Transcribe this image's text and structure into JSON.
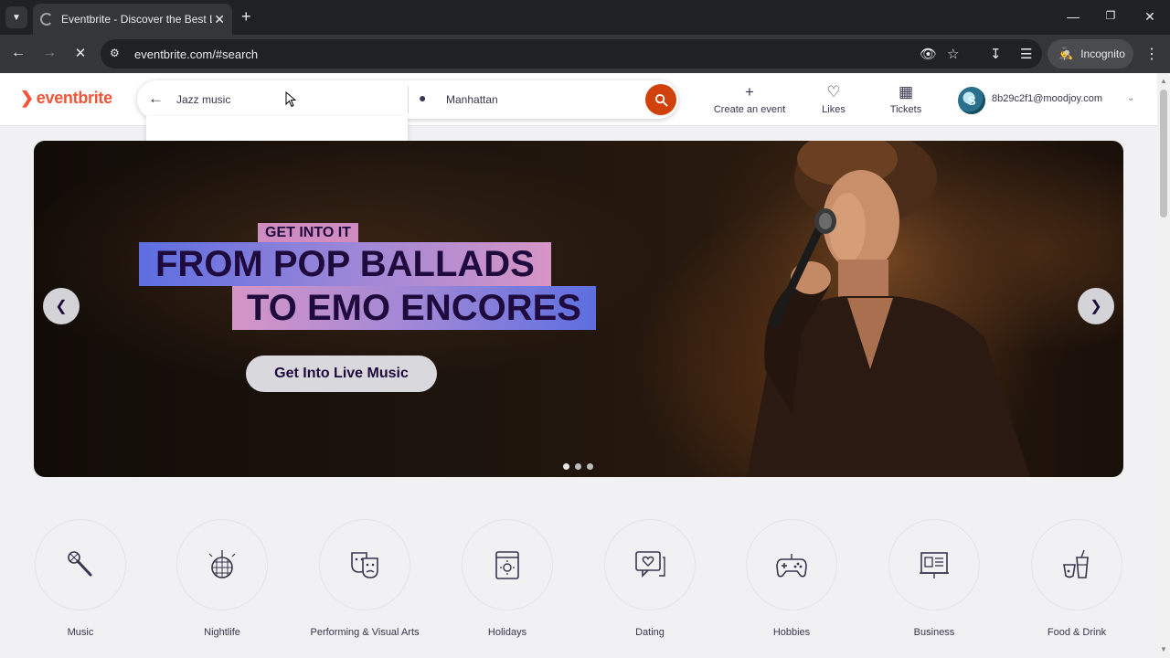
{
  "browser": {
    "tab_title": "Eventbrite - Discover the Best L",
    "url": "eventbrite.com/#search",
    "incognito_label": "Incognito"
  },
  "header": {
    "logo": "eventbrite",
    "search_query": "Jazz music",
    "location": "Manhattan",
    "create_event": "Create an event",
    "likes": "Likes",
    "tickets": "Tickets",
    "user_email": "8b29c2f1@moodjoy.com",
    "avatar_letter": "S"
  },
  "hero": {
    "tag": "GET INTO IT",
    "line1": "FROM POP BALLADS",
    "line2": "TO EMO ENCORES",
    "cta": "Get Into Live Music",
    "slide_count": 3,
    "active_slide": 1
  },
  "categories": [
    {
      "label": "Music",
      "icon": "microphone-icon"
    },
    {
      "label": "Nightlife",
      "icon": "disco-ball-icon"
    },
    {
      "label": "Performing & Visual Arts",
      "icon": "theater-masks-icon"
    },
    {
      "label": "Holidays",
      "icon": "calendar-icon"
    },
    {
      "label": "Dating",
      "icon": "chat-heart-icon"
    },
    {
      "label": "Hobbies",
      "icon": "gamepad-icon"
    },
    {
      "label": "Business",
      "icon": "presentation-icon"
    },
    {
      "label": "Food & Drink",
      "icon": "drinks-icon"
    }
  ],
  "colors": {
    "brand": "#f05537",
    "search_button": "#d1410c",
    "text_dark": "#1e0a3c"
  }
}
